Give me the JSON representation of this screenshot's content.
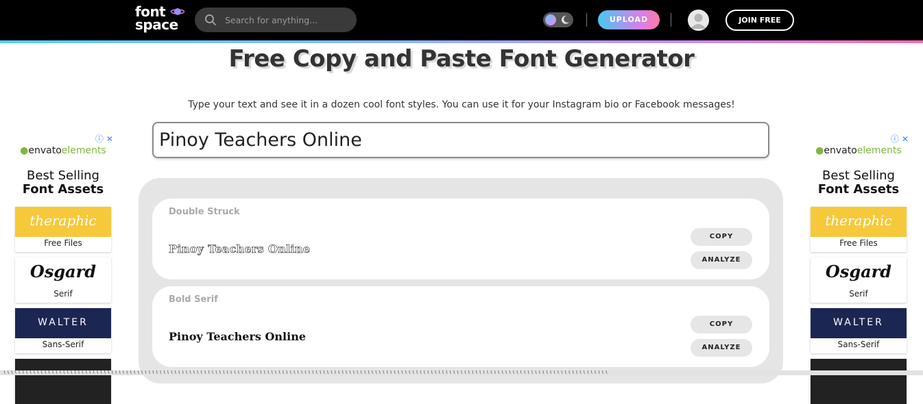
{
  "header": {
    "logo_line1": "font",
    "logo_line2": "space",
    "search_placeholder": "Search for anything...",
    "upload_label": "UPLOAD",
    "join_label": "JOIN FREE"
  },
  "main": {
    "title": "Free Copy and Paste Font Generator",
    "subtitle": "Type your text and see it in a dozen cool font styles. You can use it for your Instagram bio or Facebook messages!",
    "input_value": "Pinoy Teachers Online"
  },
  "results": [
    {
      "style": "Double Struck",
      "text": "Pinoy Teachers Online",
      "copy_label": "COPY",
      "analyze_label": "ANALYZE"
    },
    {
      "style": "Bold Serif",
      "text": "Pinoy Teachers Online",
      "copy_label": "COPY",
      "analyze_label": "ANALYZE"
    }
  ],
  "ad": {
    "brand_a": "envato",
    "brand_b": "elements",
    "heading_line1": "Best Selling",
    "heading_line2": "Font Assets",
    "tiles": [
      {
        "label": "Free Files",
        "art": "theraphic"
      },
      {
        "label": "Serif",
        "art": "Osgard"
      },
      {
        "label": "Sans-Serif",
        "art": "WALTER"
      }
    ]
  },
  "status_text": "(((((((((((((((((((((((((((((((((((((((((((((((((((((((((((((((((((((((((((((((((((((((((((((((((((((((((((((((((((((((((((((((((((((((((((((((((((((((((((((((((((",
  "colors": {
    "accent_gradient_start": "#48c8f2",
    "accent_gradient_end": "#ff79a6",
    "envato_green": "#82b541"
  }
}
